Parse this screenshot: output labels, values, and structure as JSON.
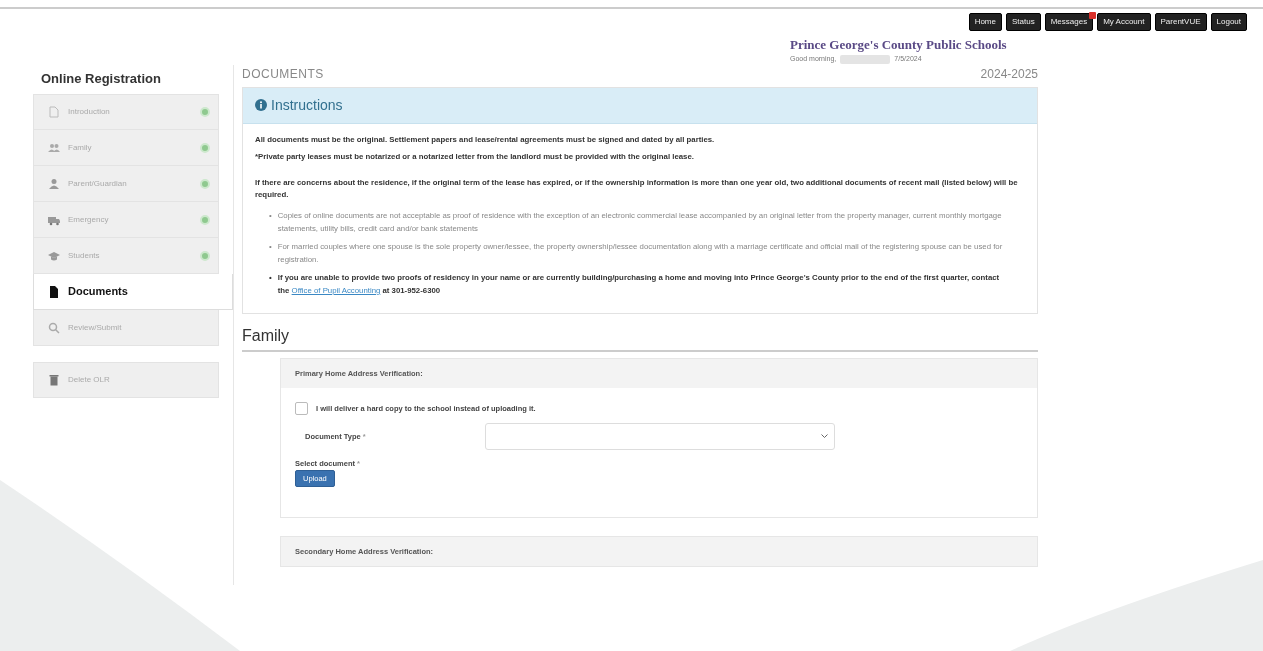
{
  "top_nav": [
    {
      "label": "Home",
      "alert": false
    },
    {
      "label": "Status",
      "alert": false
    },
    {
      "label": "Messages",
      "alert": true
    },
    {
      "label": "My Account",
      "alert": false
    },
    {
      "label": "ParentVUE",
      "alert": false
    },
    {
      "label": "Logout",
      "alert": false
    }
  ],
  "header": {
    "title": "Prince George's County Public Schools",
    "greeting": "Good morning,",
    "date": "7/5/2024"
  },
  "sidebar": {
    "title": "Online Registration",
    "items": [
      {
        "label": "Introduction",
        "complete": true,
        "selected": false
      },
      {
        "label": "Family",
        "complete": true,
        "selected": false
      },
      {
        "label": "Parent/Guardian",
        "complete": true,
        "selected": false
      },
      {
        "label": "Emergency",
        "complete": true,
        "selected": false
      },
      {
        "label": "Students",
        "complete": true,
        "selected": false
      },
      {
        "label": "Documents",
        "complete": false,
        "selected": true
      },
      {
        "label": "Review/Submit",
        "complete": false,
        "selected": false
      }
    ],
    "actions": [
      {
        "label": "Delete OLR"
      }
    ]
  },
  "page": {
    "heading": "DOCUMENTS",
    "year": "2024-2025"
  },
  "instructions": {
    "title": "Instructions",
    "paragraphs": [
      "All documents must be the original.  Settlement papers and lease/rental agreements must be signed and dated by all parties.",
      "*Private party leases must be notarized or a notarized letter from the landlord must be provided with the original lease.",
      "If there are concerns about the residence, if the original term of the lease has expired, or if the ownership information is more than one year old, two additional documents of recent mail (listed below) will be required."
    ],
    "bullets": [
      {
        "marker": "•",
        "text": "Copies of online documents are not acceptable as proof of residence with the exception of an electronic commercial lease accompanied by an original letter from the property manager, current monthly mortgage statements, utility bills, credit card and/or bank statements",
        "bold": false
      },
      {
        "marker": "•",
        "text": "For married couples where one spouse is the sole property owner/lessee, the property ownership/lessee documentation along with a marriage certificate and official mail of the registering spouse can be used for registration.",
        "bold": false
      },
      {
        "marker": "•",
        "text": "If you are unable to provide two proofs of residency in your name or are currently building/purchasing a home and moving into Prince George's County prior to the end of the first quarter, contact the",
        "link": "Office of Pupil Accounting",
        "after": "at 301-952-6300",
        "bold": true
      }
    ]
  },
  "family": {
    "heading": "Family",
    "sections": [
      {
        "title": "Primary Home Address Verification:",
        "hard_copy": {
          "label": "I will deliver a hard copy to the school instead of uploading it.",
          "checked": false
        },
        "document_type": {
          "label": "Document Type",
          "mark": "*"
        },
        "select": {
          "label": "Select document",
          "mark": "*"
        },
        "upload_button": "Upload"
      },
      {
        "title": "Secondary Home Address Verification:"
      }
    ]
  }
}
